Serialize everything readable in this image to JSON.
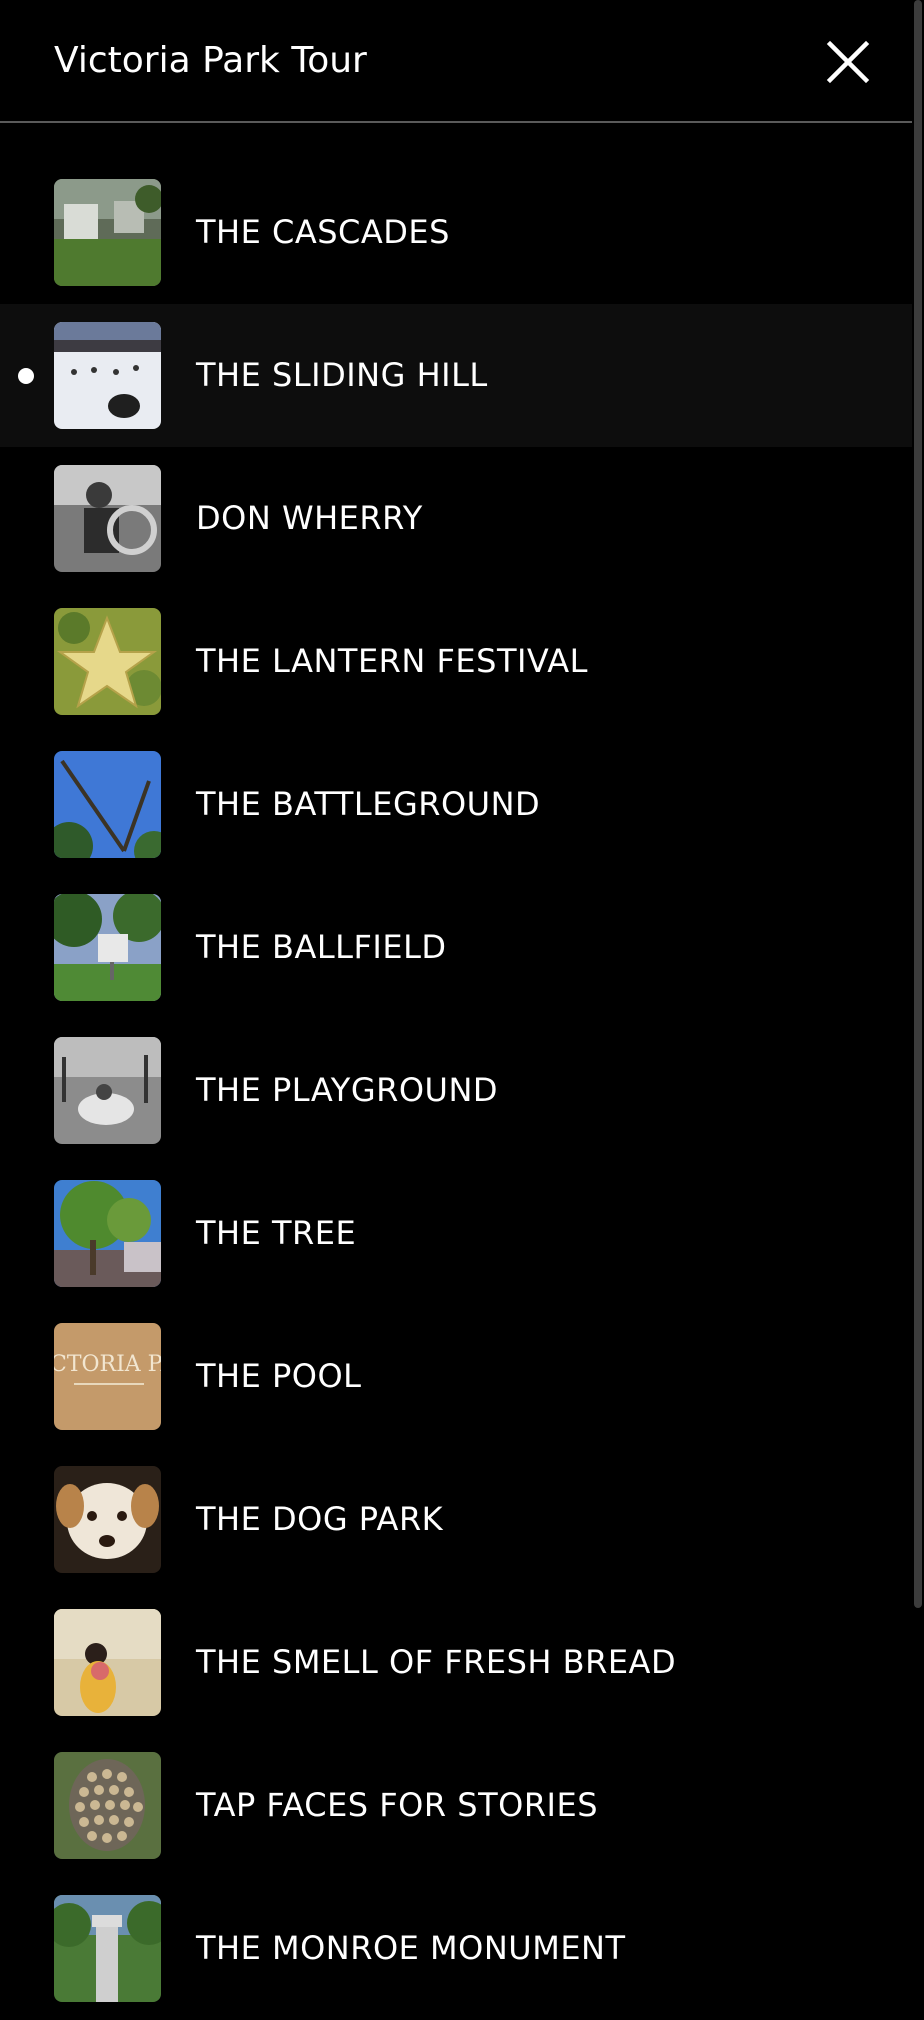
{
  "header": {
    "title": "Victoria Park Tour",
    "close_icon": "close-icon"
  },
  "stops": [
    {
      "label": "THE CASCADES",
      "thumb": "cascades-photo",
      "active": false
    },
    {
      "label": "THE SLIDING HILL",
      "thumb": "sliding-hill-photo",
      "active": true
    },
    {
      "label": "DON WHERRY",
      "thumb": "don-wherry-photo",
      "active": false
    },
    {
      "label": "THE LANTERN FESTIVAL",
      "thumb": "lantern-festival-photo",
      "active": false
    },
    {
      "label": "THE BATTLEGROUND",
      "thumb": "battleground-photo",
      "active": false
    },
    {
      "label": "THE BALLFIELD",
      "thumb": "ballfield-photo",
      "active": false
    },
    {
      "label": "THE PLAYGROUND",
      "thumb": "playground-photo",
      "active": false
    },
    {
      "label": "THE TREE",
      "thumb": "tree-photo",
      "active": false
    },
    {
      "label": "THE POOL",
      "thumb": "pool-sign-photo",
      "thumb_text": "CTORIA PA",
      "active": false
    },
    {
      "label": "THE DOG PARK",
      "thumb": "dog-photo",
      "active": false
    },
    {
      "label": "THE SMELL OF FRESH BREAD",
      "thumb": "fresh-bread-photo",
      "active": false
    },
    {
      "label": "TAP FACES FOR STORIES",
      "thumb": "faces-mosaic-photo",
      "active": false
    },
    {
      "label": "THE MONROE MONUMENT",
      "thumb": "monroe-monument-photo",
      "active": false
    }
  ],
  "colors": {
    "background": "#000000",
    "active_row": "#0d0d0d",
    "divider": "#5a5a5a",
    "text": "#ffffff"
  }
}
